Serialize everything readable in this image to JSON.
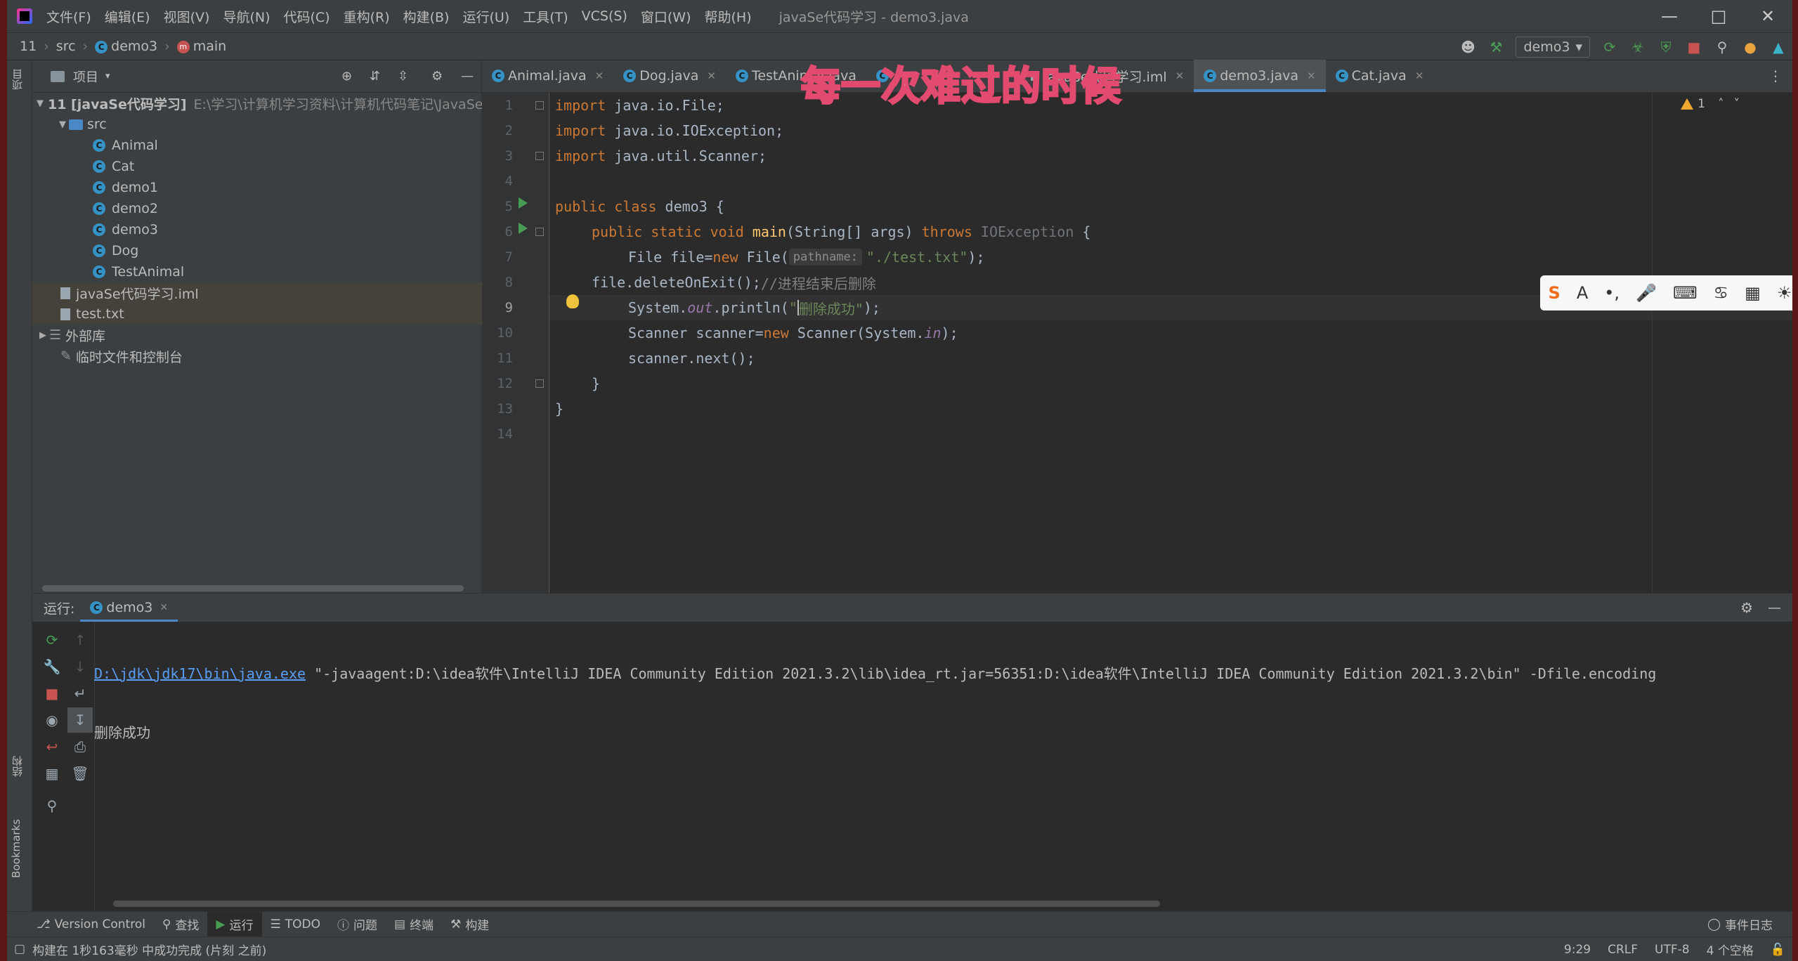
{
  "window": {
    "title": "javaSe代码学习 - demo3.java"
  },
  "menu": [
    "文件(F)",
    "编辑(E)",
    "视图(V)",
    "导航(N)",
    "代码(C)",
    "重构(R)",
    "构建(B)",
    "运行(U)",
    "工具(T)",
    "VCS(S)",
    "窗口(W)",
    "帮助(H)"
  ],
  "breadcrumb": {
    "project": "11",
    "folder": "src",
    "file": "demo3",
    "method": "main"
  },
  "run_config": "demo3",
  "project_panel": {
    "title": "项目",
    "root_label": "11 [javaSe代码学习]",
    "root_path": "E:\\学习\\计算机学习资料\\计算机代码笔记\\JavaSe\\",
    "src": "src",
    "classes": [
      "Animal",
      "Cat",
      "demo1",
      "demo2",
      "demo3",
      "Dog",
      "TestAnimal"
    ],
    "files": [
      "javaSe代码学习.iml",
      "test.txt"
    ],
    "external": "外部库",
    "scratch": "临时文件和控制台"
  },
  "left_stripe": {
    "project": "项目",
    "structure": "结构",
    "bookmarks": "Bookmarks"
  },
  "editor_tabs": [
    "Animal.java",
    "Dog.java",
    "TestAnimal.java",
    "",
    "",
    "javaSe代码学习.iml",
    "demo3.java",
    "Cat.java"
  ],
  "active_tab": "demo3.java",
  "subtitle_overlay": "每一次难过的时候",
  "warnings": "1",
  "code": {
    "line_numbers": [
      "1",
      "2",
      "3",
      "4",
      "5",
      "6",
      "7",
      "8",
      "9",
      "10",
      "11",
      "12",
      "13",
      "14"
    ],
    "l1_kw": "import",
    "l1_rest": " java.io.File;",
    "l2_kw": "import",
    "l2_rest": " java.io.IOException;",
    "l3_kw": "import",
    "l3_rest": " java.util.Scanner;",
    "l5_kw": "public class",
    "l5_rest": " demo3 {",
    "l6_kw": "public static void",
    "l6_fn": "main",
    "l6_mid": "(String[] args) ",
    "l6_throws": "throws",
    "l6_exc": " IOException",
    "l6_end": " {",
    "l7_a": "File file=",
    "l7_new": "new",
    "l7_b": " File(",
    "l7_hint": "pathname:",
    "l7_str": "\"./test.txt\"",
    "l7_end": ");",
    "l8_a": "file.deleteOnExit();",
    "l8_cm": "//进程结束后删除",
    "l9_a": "System.",
    "l9_out": "out",
    "l9_b": ".println(",
    "l9_q": "\"",
    "l9_str": "删除成功\"",
    "l9_end": ");",
    "l10_a": "Scanner scanner=",
    "l10_new": "new",
    "l10_b": " Scanner(System.",
    "l10_in": "in",
    "l10_end": ");",
    "l11": "scanner.next();",
    "l12": "}",
    "l13": "}"
  },
  "run_panel": {
    "label": "运行:",
    "tab": "demo3",
    "cmd_link": "D:\\jdk\\jdk17\\bin\\java.exe",
    "cmd_rest": " \"-javaagent:D:\\idea软件\\IntelliJ IDEA Community Edition 2021.3.2\\lib\\idea_rt.jar=56351:D:\\idea软件\\IntelliJ IDEA Community Edition 2021.3.2\\bin\" -Dfile.encoding",
    "output": "删除成功"
  },
  "tool_windows": [
    "Version Control",
    "查找",
    "运行",
    "TODO",
    "问题",
    "终端",
    "构建"
  ],
  "event_log": "事件日志",
  "status": {
    "message": "构建在 1秒163毫秒 中成功完成 (片刻 之前)",
    "position": "9:29",
    "line_sep": "CRLF",
    "encoding": "UTF-8",
    "indent": "4 个空格"
  },
  "colors": {
    "keyword": "#cc7832",
    "string": "#6a8759",
    "function": "#ffc66d",
    "accent": "#4a88c7",
    "run_green": "#499c54"
  }
}
